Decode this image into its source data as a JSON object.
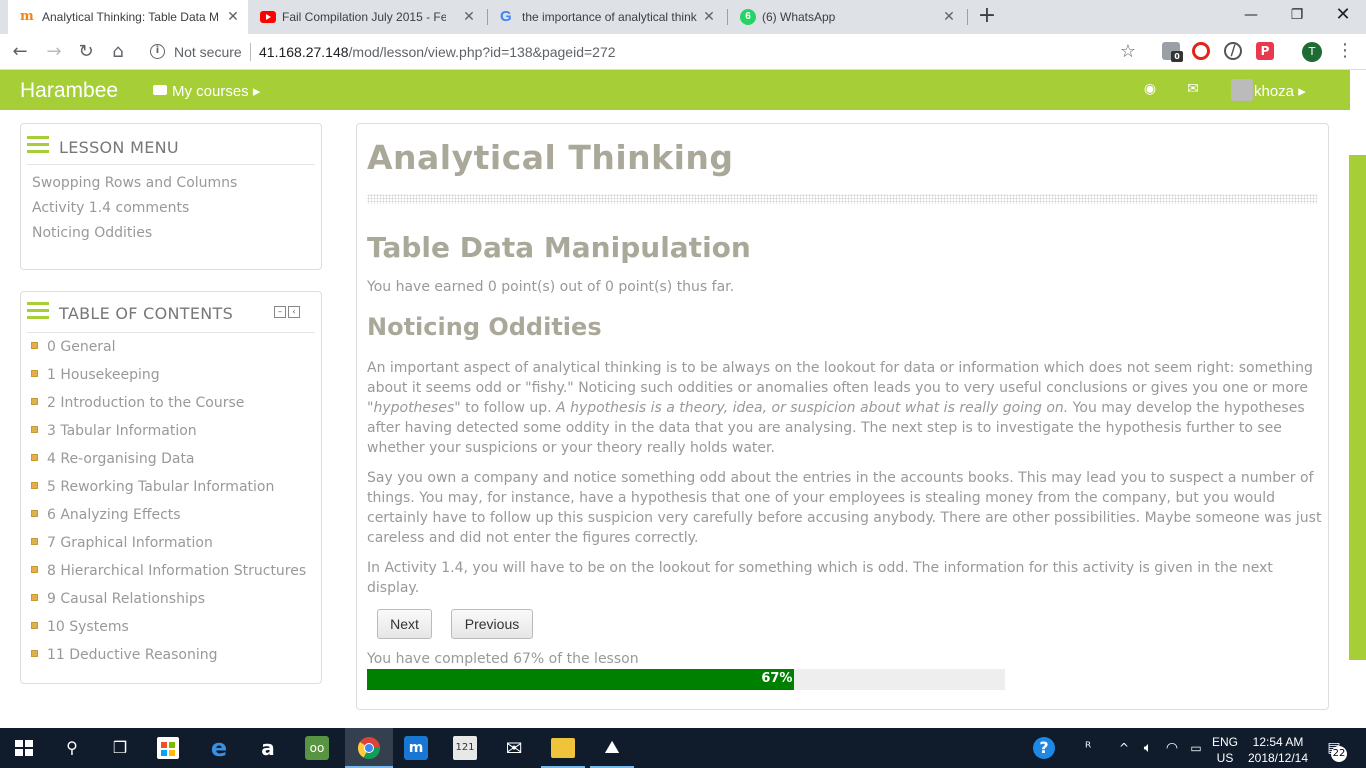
{
  "browser": {
    "tabs": [
      {
        "title": "Analytical Thinking: Table Data M",
        "active": true
      },
      {
        "title": "Fail Compilation July 2015 - Febr",
        "active": false
      },
      {
        "title": "the importance of analytical think",
        "active": false
      },
      {
        "title": "(6) WhatsApp",
        "active": false
      }
    ],
    "whatsapp_badge": "6",
    "security_label": "Not secure",
    "url_host": "41.168.27.148",
    "url_path": "/mod/lesson/view.php?id=138&pageid=272",
    "ext_badge": "0",
    "profile_initial": "T"
  },
  "header": {
    "brand": "Harambee",
    "mycourses": "My courses",
    "username": "khoza",
    "accent": "#a6cf37"
  },
  "lesson_menu": {
    "title": "LESSON MENU",
    "items": [
      "Swopping Rows and Columns",
      "Activity 1.4 comments",
      "Noticing Oddities"
    ]
  },
  "toc": {
    "title": "TABLE OF CONTENTS",
    "items": [
      "0 General",
      "1 Housekeeping",
      "2 Introduction to the Course",
      "3 Tabular Information",
      "4 Re-organising Data",
      "5 Reworking Tabular Information",
      "6 Analyzing Effects",
      "7 Graphical Information",
      "8 Hierarchical Information Structures",
      "9 Causal Relationships",
      "10 Systems",
      "11 Deductive Reasoning"
    ]
  },
  "main": {
    "title": "Analytical Thinking",
    "subtitle": "Table Data Manipulation",
    "points": "You have earned 0 point(s) out of 0 point(s) thus far.",
    "section": "Noticing Oddities",
    "p1_a": "An important aspect of analytical thinking is to be always on the lookout for data or information which does not seem right: something about it seems odd or \"fishy.\" Noticing such oddities or anomalies often leads you to very useful conclusions or gives you one or more \"",
    "p1_hyp": "hypotheses",
    "p1_b": "\" to follow up. ",
    "p1_def": "A hypothesis is a theory, idea, or suspicion about what is really going on.",
    "p1_c": " You may develop the hypotheses after having detected some oddity in the data that you are analysing. The next step is to investigate the hypothesis further to see whether your suspicions or your theory really holds water.",
    "p2": "Say you own a company and notice something odd about the entries in the accounts books. This may lead you to suspect a number of things. You may, for instance, have a hypothesis that one of your employees is stealing money from the company, but you would certainly have to follow up this suspicion very carefully before accusing anybody. There are other possibilities. Maybe someone was just careless and did not enter the figures correctly.",
    "p3": "In Activity 1.4, you will have to be on the lookout for something which is odd. The information for this activity is given in the next display.",
    "next": "Next",
    "previous": "Previous",
    "progress_label": "You have completed 67% of the lesson",
    "progress_text": "67%",
    "progress_value": 67
  },
  "taskbar": {
    "lang": "ENG",
    "region": "US",
    "time": "12:54 AM",
    "date": "2018/12/14",
    "notifications": "22"
  }
}
